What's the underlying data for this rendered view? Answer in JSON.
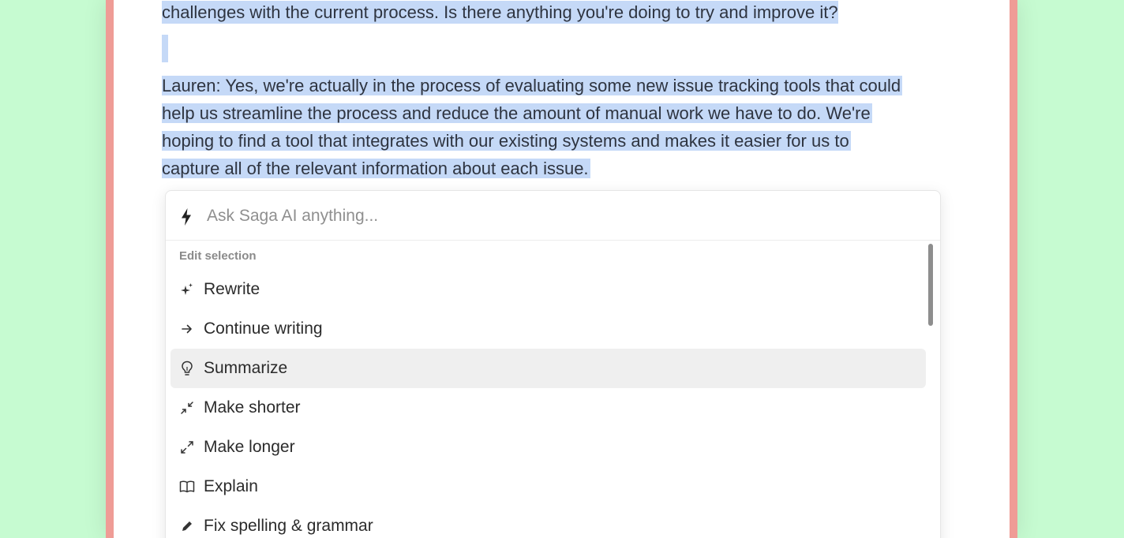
{
  "document": {
    "line1": "challenges with the current process. Is there anything you're doing to try and improve it?",
    "para2_lines": [
      "Lauren: Yes, we're actually in the process of evaluating some new issue tracking tools that could",
      "help us streamline the process and reduce the amount of manual work we have to do. We're",
      "hoping to find a tool that integrates with our existing systems and makes it easier for us to",
      "capture all of the relevant information about each issue."
    ]
  },
  "ai_popup": {
    "placeholder": "Ask Saga AI anything...",
    "section_label": "Edit selection",
    "items": [
      {
        "label": "Rewrite",
        "icon": "sparkle-icon",
        "active": false
      },
      {
        "label": "Continue writing",
        "icon": "arrow-right-icon",
        "active": false
      },
      {
        "label": "Summarize",
        "icon": "lightbulb-icon",
        "active": true
      },
      {
        "label": "Make shorter",
        "icon": "shrink-icon",
        "active": false
      },
      {
        "label": "Make longer",
        "icon": "expand-icon",
        "active": false
      },
      {
        "label": "Explain",
        "icon": "book-icon",
        "active": false
      },
      {
        "label": "Fix spelling & grammar",
        "icon": "pencil-icon",
        "active": false
      }
    ]
  },
  "colors": {
    "background": "#c6fbd1",
    "frame_accent": "#ef9c96",
    "selection": "#c5d9f7",
    "active_item": "#efefef"
  }
}
